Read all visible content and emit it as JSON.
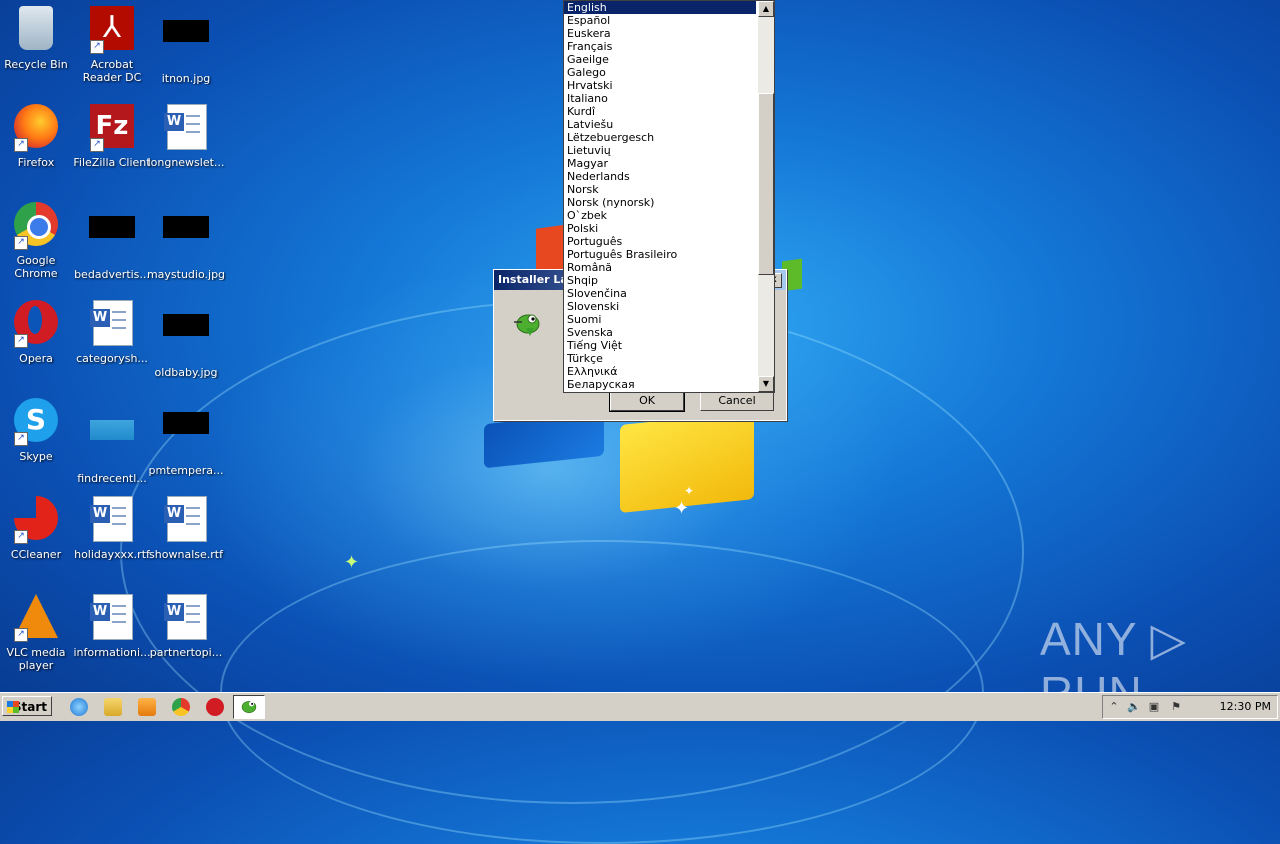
{
  "desktop": {
    "icons": [
      {
        "label": "Recycle Bin"
      },
      {
        "label": "Acrobat Reader DC"
      },
      {
        "label": "itnon.jpg"
      },
      {
        "label": "Firefox"
      },
      {
        "label": "FileZilla Client"
      },
      {
        "label": "longnewslet..."
      },
      {
        "label": "Google Chrome"
      },
      {
        "label": "bedadvertis..."
      },
      {
        "label": "maystudio.jpg"
      },
      {
        "label": "Opera"
      },
      {
        "label": "categorysh..."
      },
      {
        "label": "oldbaby.jpg"
      },
      {
        "label": "Skype"
      },
      {
        "label": "findrecentl..."
      },
      {
        "label": "pmtempera..."
      },
      {
        "label": "CCleaner"
      },
      {
        "label": "holidayxxx.rtf"
      },
      {
        "label": "shownalse.rtf"
      },
      {
        "label": "VLC media player"
      },
      {
        "label": "informationi..."
      },
      {
        "label": "partnertopi..."
      }
    ],
    "icon_glyphs": {
      "acrobat": "⅄",
      "filezilla": "Fz",
      "skype": "S",
      "word": "W",
      "shortcut": "↗"
    }
  },
  "dialog": {
    "title": "Installer Language",
    "ok_label": "OK",
    "cancel_label": "Cancel",
    "close_glyph": "x"
  },
  "language_list": {
    "selected": "English",
    "items": [
      "English",
      "Español",
      "Euskera",
      "Français",
      "Gaeilge",
      "Galego",
      "Hrvatski",
      "Italiano",
      "Kurdî",
      "Latviešu",
      "Lëtzebuergesch",
      "Lietuvių",
      "Magyar",
      "Nederlands",
      "Norsk",
      "Norsk (nynorsk)",
      "O`zbek",
      "Polski",
      "Português",
      "Português Brasileiro",
      "Română",
      "Shqip",
      "Slovenčina",
      "Slovenski",
      "Suomi",
      "Svenska",
      "Tiếng Việt",
      "Türkçe",
      "Ελληνικά",
      "Беларуская"
    ],
    "scroll_up_glyph": "▲",
    "scroll_down_glyph": "▼"
  },
  "taskbar": {
    "start_label": "Start",
    "clock": "12:30 PM",
    "tray_glyphs": {
      "chevron": "⌃",
      "volume": "🔈",
      "network": "▣",
      "flag": "⚑"
    }
  },
  "watermark": "ANY ▷ RUN"
}
